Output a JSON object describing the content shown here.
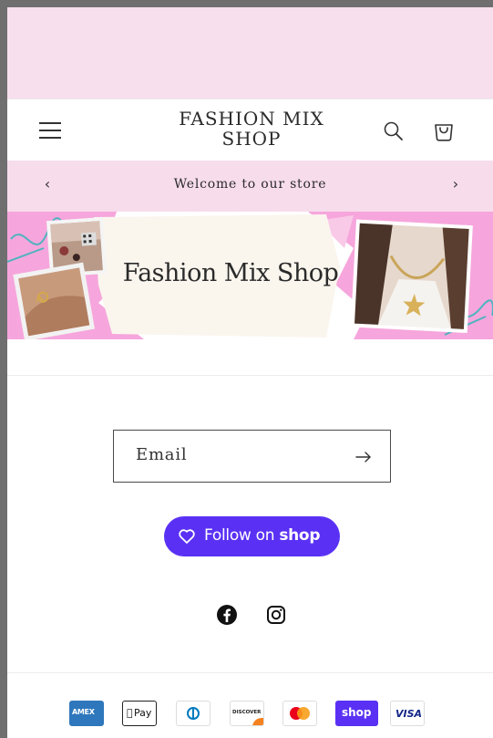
{
  "header": {
    "logo_line1": "FASHION MIX",
    "logo_line2": "SHOP",
    "menu_icon": "hamburger-menu-icon",
    "search_icon": "search-icon",
    "cart_icon": "cart-icon"
  },
  "announcement": {
    "text": "Welcome to our store",
    "prev": "‹",
    "next": "›"
  },
  "banner": {
    "title": "Fashion Mix Shop"
  },
  "newsletter": {
    "email_label": "Email",
    "submit_icon": "arrow-right-icon"
  },
  "follow": {
    "label_prefix": "Follow on ",
    "label_brand": "shop",
    "icon": "heart-icon",
    "color": "#5a31f4"
  },
  "social": [
    {
      "name": "facebook-icon"
    },
    {
      "name": "instagram-icon"
    }
  ],
  "payments": [
    {
      "name": "American Express",
      "label": "AMEX",
      "color": "#2e77bc"
    },
    {
      "name": "Apple Pay",
      "label": "Pay"
    },
    {
      "name": "Diners Club"
    },
    {
      "name": "Discover",
      "label": "DISCOVER"
    },
    {
      "name": "Mastercard"
    },
    {
      "name": "Shop Pay",
      "label": "shop",
      "color": "#5a31f4"
    },
    {
      "name": "Visa",
      "label": "VISA",
      "color": "#142787"
    }
  ],
  "colors": {
    "pink": "#f8dfee",
    "border": "#4a4a4a"
  }
}
